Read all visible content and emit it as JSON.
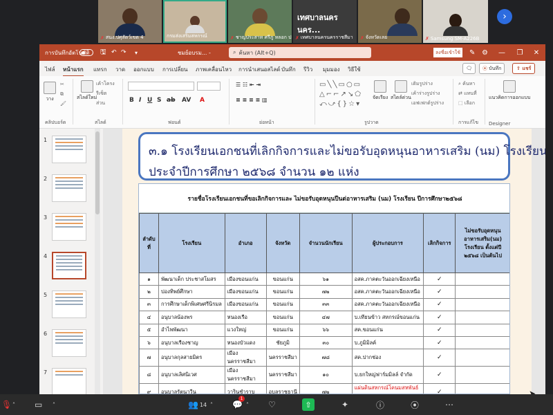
{
  "meeting": {
    "participants": [
      {
        "name": "สนง.ปศุสัตว์เขต 4",
        "mic_off": true
      },
      {
        "name": "กรมส่งเสริมสหกรณ์",
        "mic_off": false
      },
      {
        "name": "ชาญประสาท ศรีภู หลอก ปศุสัตว์จัง...",
        "mic_off": true
      },
      {
        "name": "เทศบาลนครนครราชสีมา",
        "mic_off": true,
        "big_label": "เทศบาลนครนคร..."
      },
      {
        "name": "จังหวัดเลย",
        "mic_off": true
      },
      {
        "name": "Samsung SM-A226B",
        "mic_off": true
      }
    ],
    "next_icon": "chevron-right-icon"
  },
  "powerpoint": {
    "autosave_label": "การบันทึกอัตโนมัติ",
    "filename": "ชมย์อบรม... -",
    "search_placeholder": "ค้นหา (Alt+Q)",
    "signin_label": "ลงชื่อเข้าใช้",
    "accent": "#b7472a",
    "tabs": [
      "ไฟล์",
      "หน้าแรก",
      "แทรก",
      "วาด",
      "ออกแบบ",
      "การเปลี่ยน",
      "ภาพเคลื่อนไหว",
      "การนำเสนอสไลด์",
      "บันทึก",
      "รีวิว",
      "มุมมอง",
      "วิธีใช้"
    ],
    "active_tab": "หน้าแรก",
    "record_label": "บันทึก",
    "share_label": "แชร์",
    "ribbon": {
      "groups": [
        "คลิปบอร์ด",
        "สไลด์",
        "ฟอนต์",
        "ย่อหน้า",
        "รูปวาด",
        "การแก้ไข",
        "Designer"
      ],
      "new_slide": "สไลด์ใหม่",
      "layout": "เค้าโครง",
      "reset": "รีเซ็ต",
      "section": "ส่วน",
      "paste": "วาง",
      "arrange": "จัดเรียง",
      "quick_styles": "สไตล์ด่วน",
      "shape_fill": "เติมรูปร่าง",
      "shape_outline": "เค้าร่างรูปร่าง",
      "shape_effects": "เอฟเฟกต์รูปร่าง",
      "find": "ค้นหา",
      "replace": "แทนที่",
      "select": "เลือก",
      "design_ideas": "แนวคิดการออกแบบ"
    },
    "thumbnails": [
      "1",
      "2",
      "3",
      "4",
      "5",
      "6",
      "7"
    ],
    "active_thumb": "4"
  },
  "slide": {
    "title_line1": "๓.๑ โรงเรียนเอกชนที่เลิกกิจการและไม่ขอรับอุดหนุนอาหารเสริม (นม) โรงเรียน",
    "title_line2": "ประจำปีการศึกษา ๒๕๖๘ จำนวน ๑๒ แห่ง",
    "table_caption": "รายชื่อโรงเรียนเอกชนที่ขอเลิกกิจการและ ไม่ขอรับอุดหนุนปีนต่อาหารเสริม (นม) โรงเรียน ปีการศึกษา๒๕๖๘",
    "headers": [
      "ลำดับที่",
      "โรงเรียน",
      "อำเภอ",
      "จังหวัด",
      "จำนวนนักเรียน",
      "ผู้ประกอบการ",
      "เลิกกิจการ",
      "ไม่ขอรับอุดหนุน อาหารเสริม(นม) โรงเรียน ตั้งแต่ปี ๒๕๖๘ เป็นต้นไป"
    ],
    "rows": [
      {
        "no": "๑",
        "school": "พัฒนาเด็ก ประชาสโมสร",
        "district": "เมืองขอนแก่น",
        "province": "ขอนแก่น",
        "students": "๖๑",
        "operator": "อสค.ภาคตะวันออกเฉียงเหนือ",
        "closed": "✓",
        "no_subsidy": "",
        "operator_red": false
      },
      {
        "no": "๒",
        "school": "ปองทิพย์ศึกษา",
        "district": "เมืองขอนแก่น",
        "province": "ขอนแก่น",
        "students": "๗๒",
        "operator": "อสค.ภาคตะวันออกเฉียงเหนือ",
        "closed": "✓",
        "no_subsidy": "",
        "operator_red": false
      },
      {
        "no": "๓",
        "school": "การศึกษาเด็กพิเศษศรีนิรมล",
        "district": "เมืองขอนแก่น",
        "province": "ขอนแก่น",
        "students": "๓๓",
        "operator": "อสค.ภาคตะวันออกเฉียงเหนือ",
        "closed": "✓",
        "no_subsidy": "",
        "operator_red": false
      },
      {
        "no": "๔",
        "school": "อนุบาลน้องพร",
        "district": "หนองเรือ",
        "province": "ขอนแก่น",
        "students": "๔๗",
        "operator": "บ.เทียนข้าว สหกรณ์ขอนแก่น",
        "closed": "✓",
        "no_subsidy": "",
        "operator_red": false
      },
      {
        "no": "๕",
        "school": "อำไพพัฒนา",
        "district": "แวงใหญ่",
        "province": "ขอนแก่น",
        "students": "๖๖",
        "operator": "สค.ขอนแก่น",
        "closed": "✓",
        "no_subsidy": "",
        "operator_red": false
      },
      {
        "no": "๖",
        "school": "อนุบาลเรืองชาญ",
        "district": "หนองบัวแดง",
        "province": "ชัยภูมิ",
        "students": "๓๐",
        "operator": "บ.ภูมิมิลค์",
        "closed": "✓",
        "no_subsidy": "",
        "operator_red": false
      },
      {
        "no": "๗",
        "school": "อนุบาลกุลสายมิตร",
        "district": "เมืองนครราชสีมา",
        "province": "นครราชสีมา",
        "students": "๗๘",
        "operator": "สค.ปากช่อง",
        "closed": "✓",
        "no_subsidy": "",
        "operator_red": false
      },
      {
        "no": "๘",
        "school": "อนุบาลเลิศนิเวศ",
        "district": "เมืองนครราชสีมา",
        "province": "นครราชสีมา",
        "students": "๑๐",
        "operator": "บ.ยกใหญ่ฟาร์มมิลล์ จำกัด",
        "closed": "✓",
        "no_subsidy": "",
        "operator_red": false
      },
      {
        "no": "๙",
        "school": "อนุบาลรัตนาวีน",
        "district": "วารินชำราบ",
        "province": "อุบลราชธานี",
        "students": "๗๒",
        "operator": "แผ่นดินสหกรณ์โคนมสหพันธ์อุบลฯ",
        "closed": "✓",
        "no_subsidy": "",
        "operator_red": true
      }
    ]
  },
  "toolbar": {
    "participants_count": "14",
    "chat_badge": "1"
  }
}
